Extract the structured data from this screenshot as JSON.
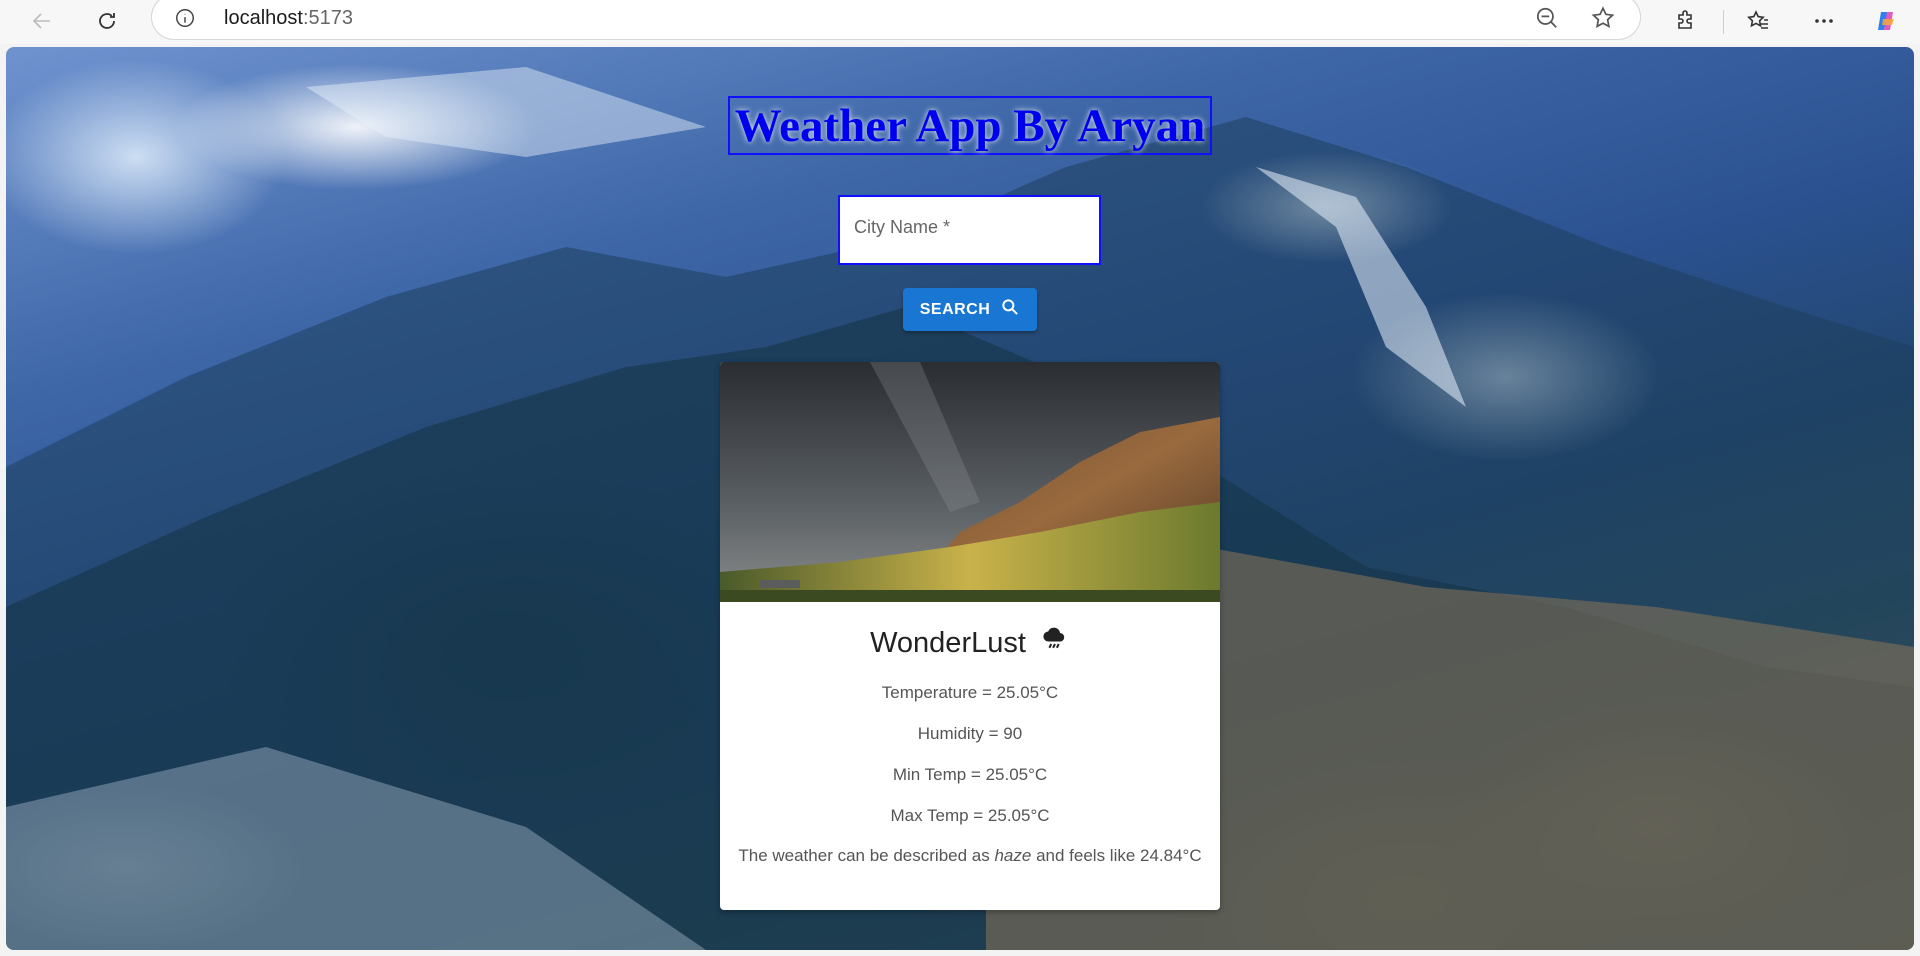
{
  "browser": {
    "url_host": "localhost",
    "url_port": ":5173"
  },
  "app": {
    "title": "Weather App By Aryan",
    "city_field": {
      "placeholder": "City Name *",
      "value": ""
    },
    "search_button": "SEARCH"
  },
  "weather": {
    "city": "WonderLust",
    "condition_icon": "rain-cloud-icon",
    "temperature": "Temperature = 25.05°C",
    "humidity": "Humidity = 90",
    "min_temp": "Min Temp = 25.05°C",
    "max_temp": "Max Temp = 25.05°C",
    "description_prefix": "The weather can be described as ",
    "description": "haze",
    "description_suffix": " and feels like 24.84°C"
  },
  "colors": {
    "accent": "#1976d2",
    "title_blue": "#0000ee"
  }
}
